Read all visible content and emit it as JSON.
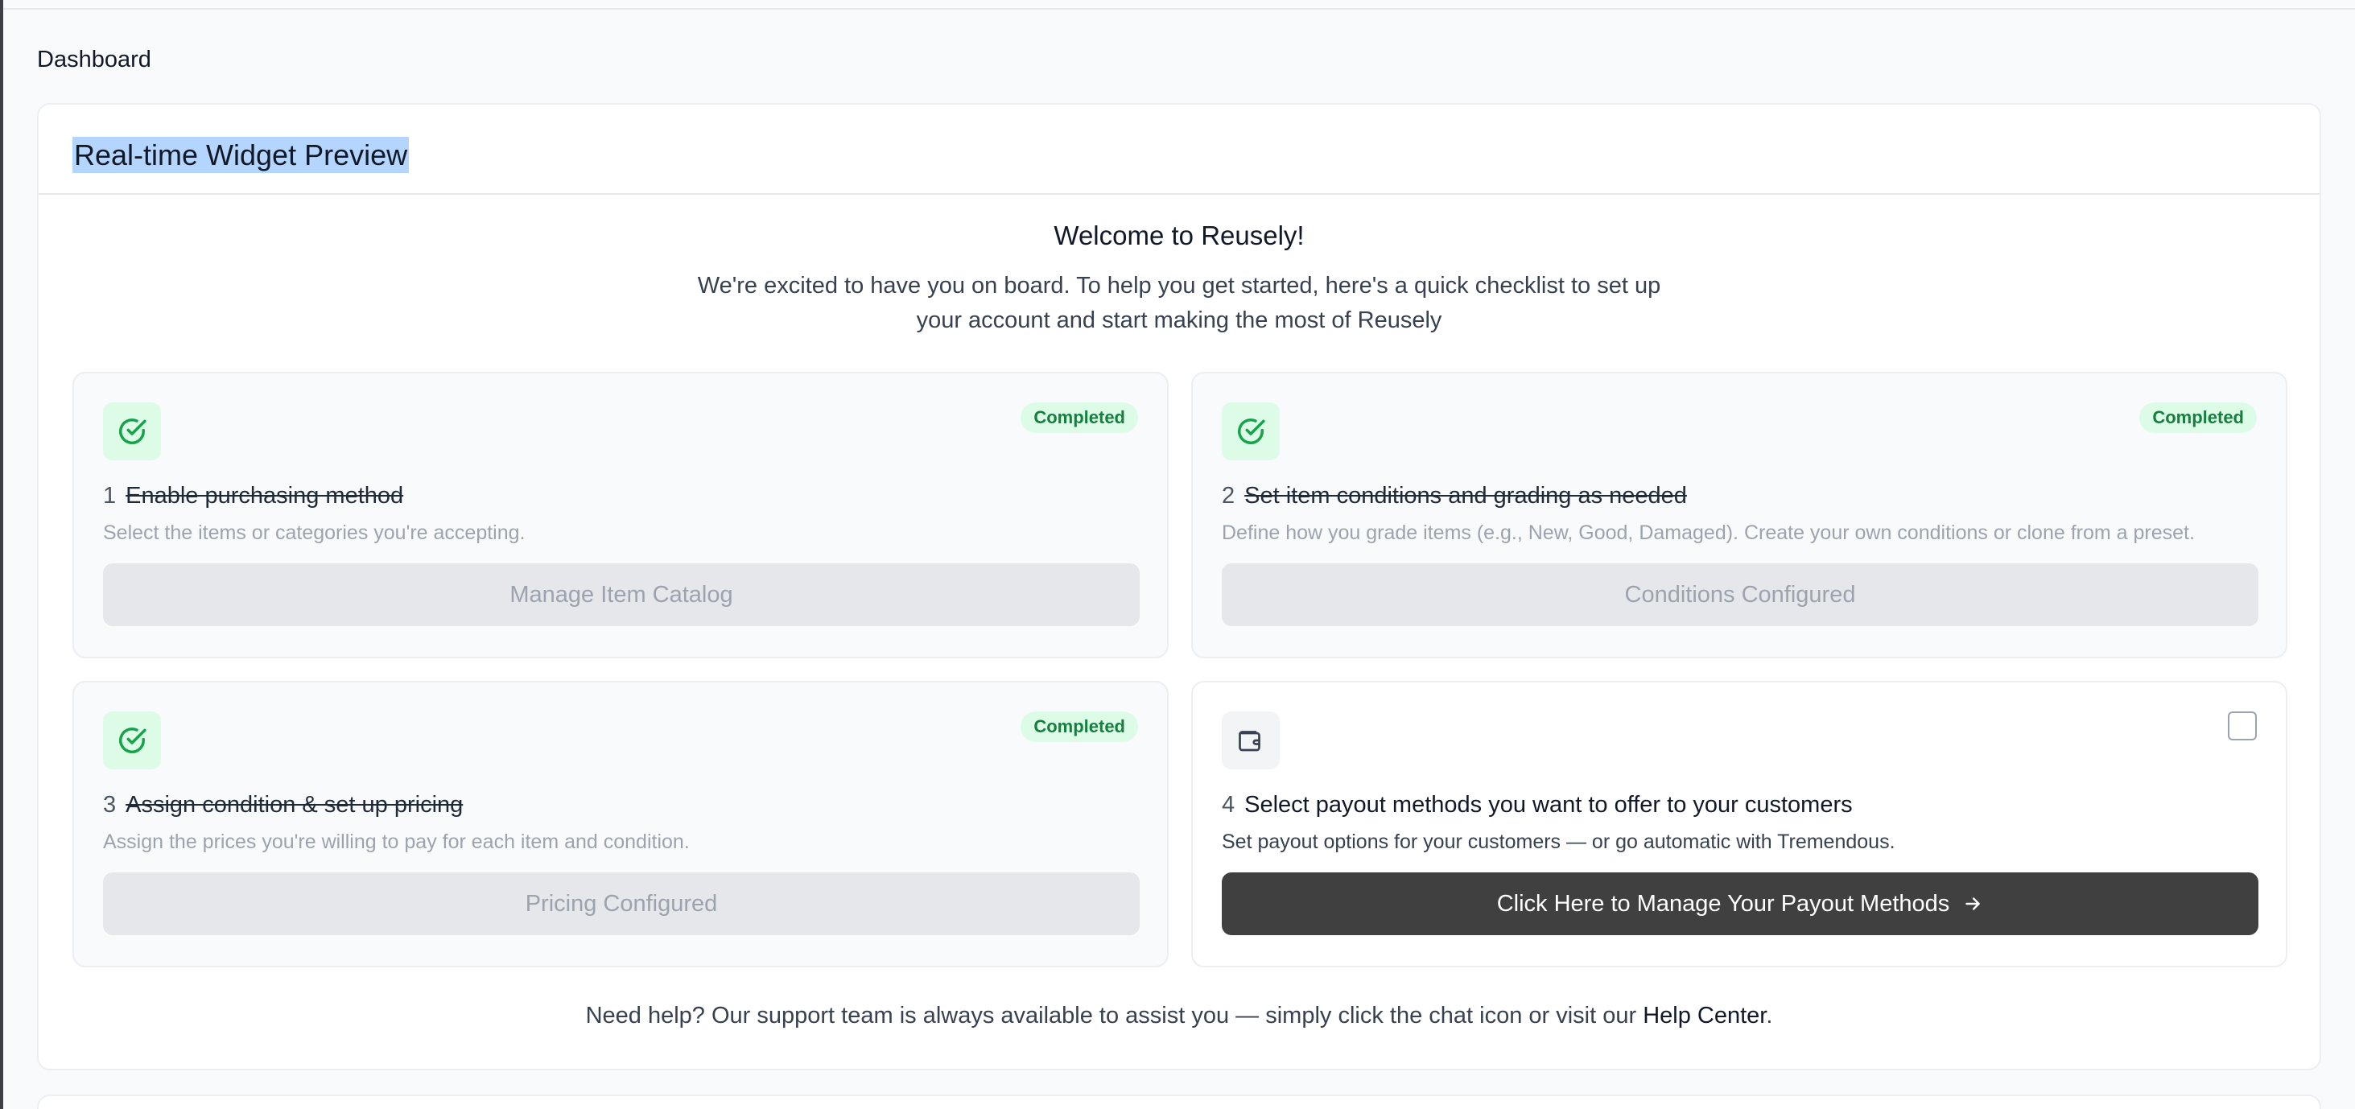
{
  "breadcrumb": "Dashboard",
  "panel": {
    "title": "Real-time Widget Preview"
  },
  "welcome": {
    "title": "Welcome to Reusely!",
    "subtitle": "We're excited to have you on board. To help you get started, here's a quick checklist to set up your account and start making the most of Reusely"
  },
  "steps": [
    {
      "number": "1",
      "title": "Enable purchasing method",
      "description": "Select the items or categories you're accepting.",
      "badge": "Completed",
      "button": "Manage Item Catalog",
      "icon": "check-circle-icon"
    },
    {
      "number": "2",
      "title": "Set item conditions and grading as needed",
      "description": "Define how you grade items (e.g., New, Good, Damaged). Create your own conditions or clone from a preset.",
      "badge": "Completed",
      "button": "Conditions Configured",
      "icon": "check-circle-icon"
    },
    {
      "number": "3",
      "title": "Assign condition & set up pricing",
      "description": "Assign the prices you're willing to pay for each item and condition.",
      "badge": "Completed",
      "button": "Pricing Configured",
      "icon": "check-circle-icon"
    },
    {
      "number": "4",
      "title": "Select payout methods you want to offer to your customers",
      "description": "Set payout options for your customers — or go automatic with Tremendous.",
      "button": "Click Here to Manage Your Payout Methods",
      "icon": "wallet-icon"
    }
  ],
  "help": {
    "text": "Need help? Our support team is always available to assist you — simply click the chat icon or visit our ",
    "link": "Help Center",
    "suffix": "."
  },
  "colors": {
    "success_bg": "#dcfce7",
    "success_text": "#15803d",
    "primary_button": "#404040",
    "disabled_button": "#e5e7eb",
    "selection_highlight": "#b4d5fe"
  }
}
